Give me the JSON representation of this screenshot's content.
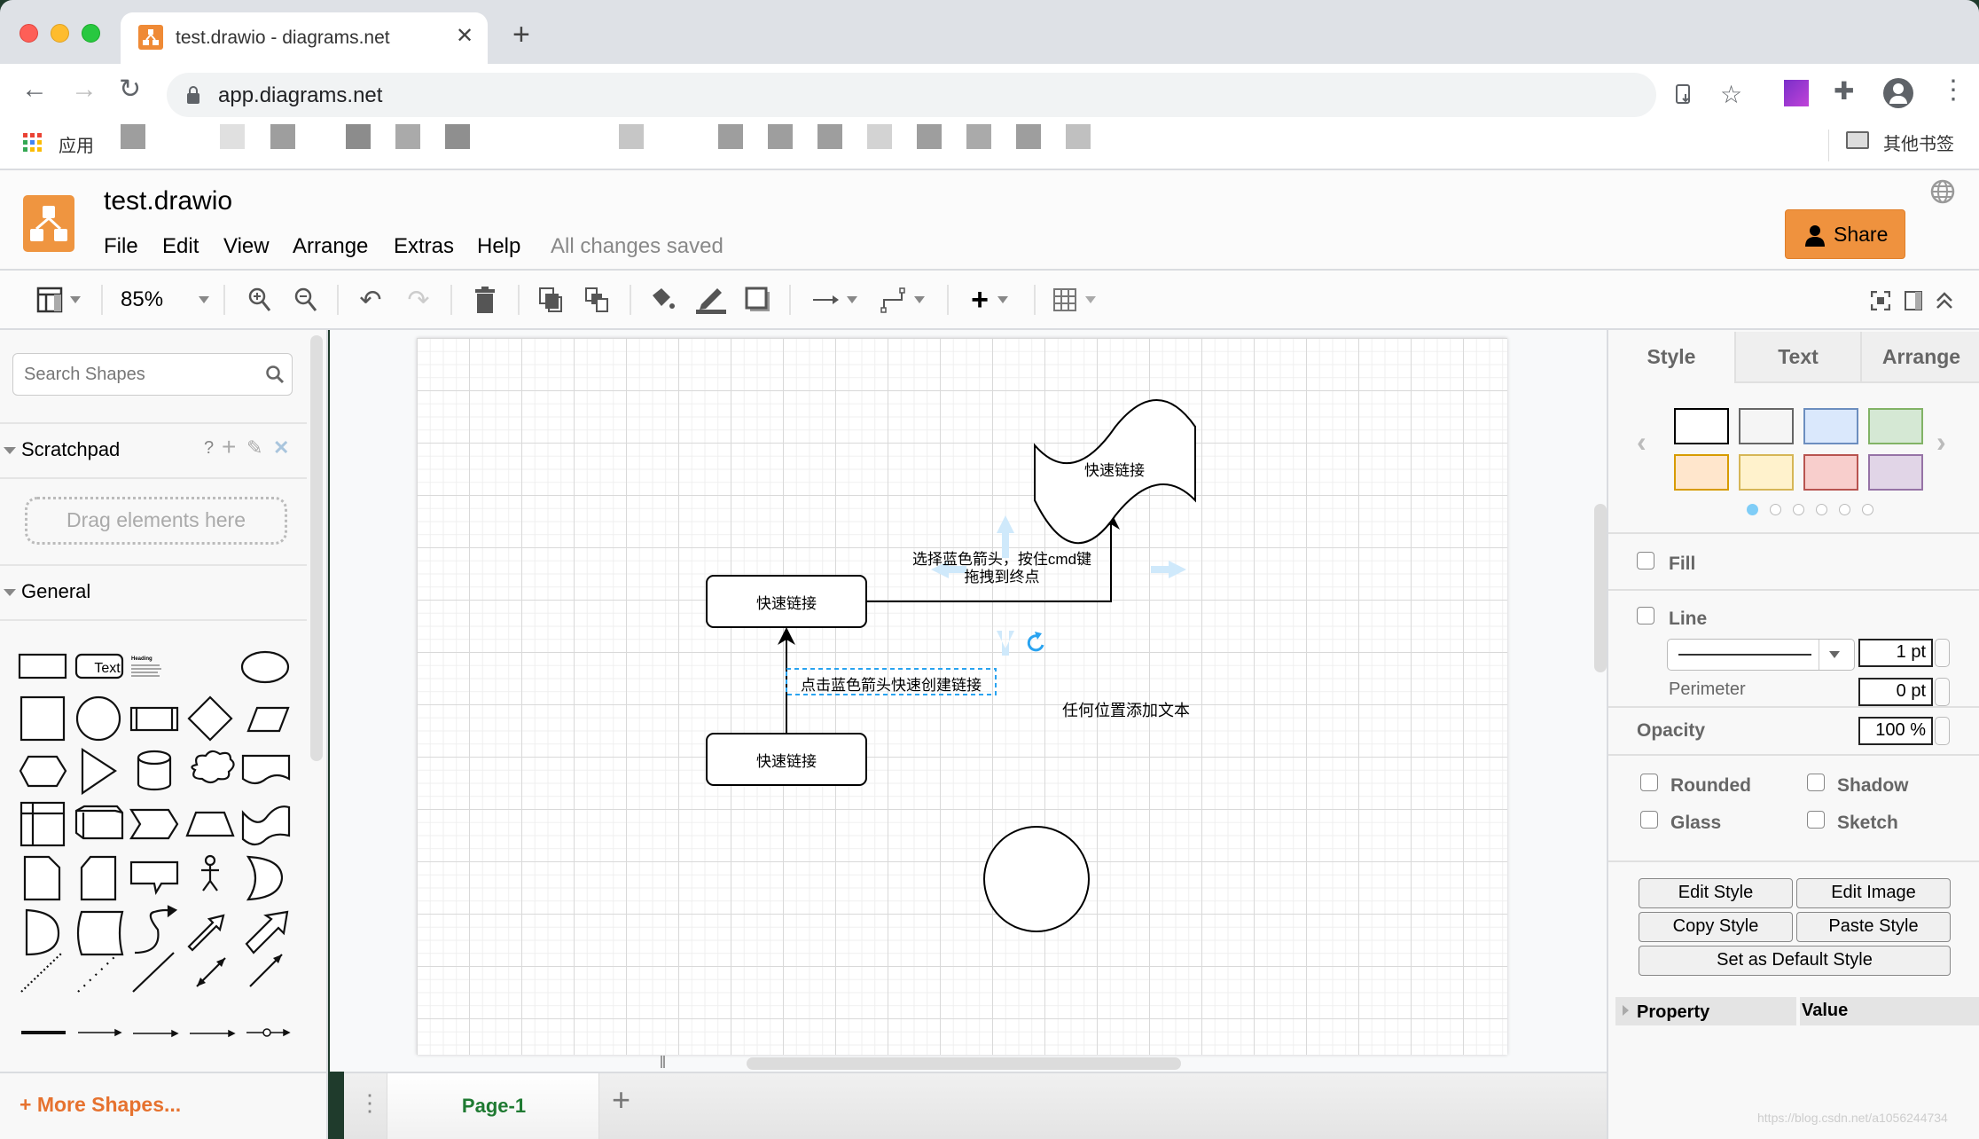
{
  "browser": {
    "tab_title": "test.drawio - diagrams.net",
    "url": "app.diagrams.net",
    "bookmarks_apps_label": "应用",
    "bookmarks_other_label": "其他书签",
    "icons": [
      "back-icon",
      "forward-icon",
      "reload-icon",
      "lock-icon",
      "install-icon",
      "star-icon",
      "extension-rp-icon",
      "puzzle-icon",
      "profile-icon",
      "more-icon"
    ]
  },
  "app": {
    "doc_title": "test.drawio",
    "menus": [
      "File",
      "Edit",
      "View",
      "Arrange",
      "Extras",
      "Help"
    ],
    "save_status": "All changes saved",
    "share_label": "Share",
    "brand_color": "#f08705"
  },
  "toolbar": {
    "zoom": "85%"
  },
  "sidebar": {
    "search_placeholder": "Search Shapes",
    "scratchpad_title": "Scratchpad",
    "scratchpad_help": "?",
    "dropzone_text": "Drag elements here",
    "general_title": "General",
    "text_shape_label": "Text",
    "heading_shape_label": "Heading",
    "more_shapes": "More Shapes..."
  },
  "diagram": {
    "nodes": [
      {
        "id": "rect-top",
        "type": "rounded-rectangle",
        "label": "快速链接"
      },
      {
        "id": "rect-bottom",
        "type": "rounded-rectangle",
        "label": "快速链接"
      },
      {
        "id": "tape",
        "type": "tape",
        "label": "快速链接"
      },
      {
        "id": "circle",
        "type": "ellipse",
        "label": ""
      }
    ],
    "edge_label_drag": [
      "选择蓝色箭头，按住cmd键",
      "拖拽到终点"
    ],
    "edge_label_click": "点击蓝色箭头快速创建链接",
    "free_text": "任何位置添加文本",
    "selection_color": "#29a3f0"
  },
  "footer": {
    "page_tab": "Page-1"
  },
  "format_panel": {
    "tabs": [
      "Style",
      "Text",
      "Arrange"
    ],
    "active_tab": "Style",
    "swatches": [
      {
        "fill": "#ffffff",
        "stroke": "#000000"
      },
      {
        "fill": "#f5f5f5",
        "stroke": "#666666"
      },
      {
        "fill": "#dae8fc",
        "stroke": "#6c8ebf"
      },
      {
        "fill": "#d5e8d4",
        "stroke": "#82b366"
      },
      {
        "fill": "#ffe6cc",
        "stroke": "#d79b00"
      },
      {
        "fill": "#fff2cc",
        "stroke": "#d6b656"
      },
      {
        "fill": "#f8cecc",
        "stroke": "#b85450"
      },
      {
        "fill": "#e1d5e7",
        "stroke": "#9673a6"
      }
    ],
    "swatch_pages": 6,
    "swatch_page_active": 1,
    "fill_label": "Fill",
    "fill_checked": false,
    "line_label": "Line",
    "line_checked": false,
    "line_width": "1 pt",
    "perimeter_label": "Perimeter",
    "perimeter_value": "0 pt",
    "opacity_label": "Opacity",
    "opacity_value": "100 %",
    "options": [
      {
        "label": "Rounded",
        "checked": false
      },
      {
        "label": "Shadow",
        "checked": false
      },
      {
        "label": "Glass",
        "checked": false
      },
      {
        "label": "Sketch",
        "checked": false
      }
    ],
    "buttons": {
      "edit_style": "Edit Style",
      "edit_image": "Edit Image",
      "copy_style": "Copy Style",
      "paste_style": "Paste Style",
      "set_default": "Set as Default Style"
    },
    "property_header": "Property",
    "value_header": "Value"
  },
  "watermark": "https://blog.csdn.net/a1056244734"
}
